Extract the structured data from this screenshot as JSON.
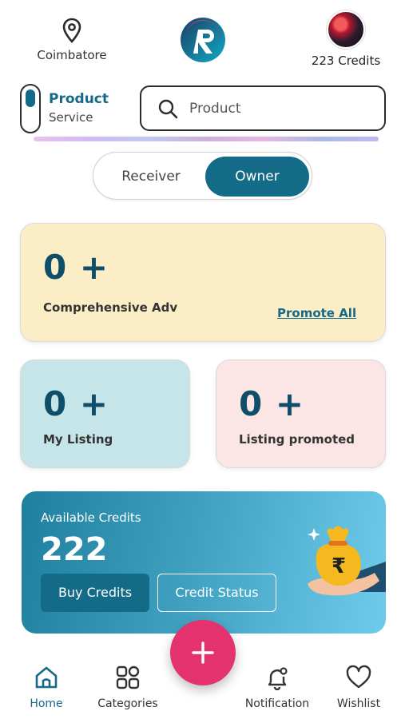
{
  "header": {
    "location": "Coimbatore",
    "credits_label": "223 Credits"
  },
  "toggle": {
    "active": "Product",
    "inactive": "Service"
  },
  "search": {
    "placeholder": "Product"
  },
  "role_switch": {
    "receiver": "Receiver",
    "owner": "Owner",
    "selected": "Owner"
  },
  "cards": {
    "adv": {
      "value": "0 +",
      "label": "Comprehensive Adv",
      "link": "Promote All"
    },
    "listing": {
      "value": "0 +",
      "label": "My Listing"
    },
    "promoted": {
      "value": "0 +",
      "label": "Listing promoted"
    }
  },
  "credits_banner": {
    "label": "Available Credits",
    "value": "222",
    "buy_button": "Buy Credits",
    "status_button": "Credit Status"
  },
  "nav": {
    "home": "Home",
    "categories": "Categories",
    "notification": "Notification",
    "wishlist": "Wishlist"
  },
  "colors": {
    "primary": "#136b88",
    "fab": "#e4326f",
    "adv_card": "#fbedc5",
    "listing_card": "#c5e5e8",
    "promoted_card": "#fce5e5"
  }
}
